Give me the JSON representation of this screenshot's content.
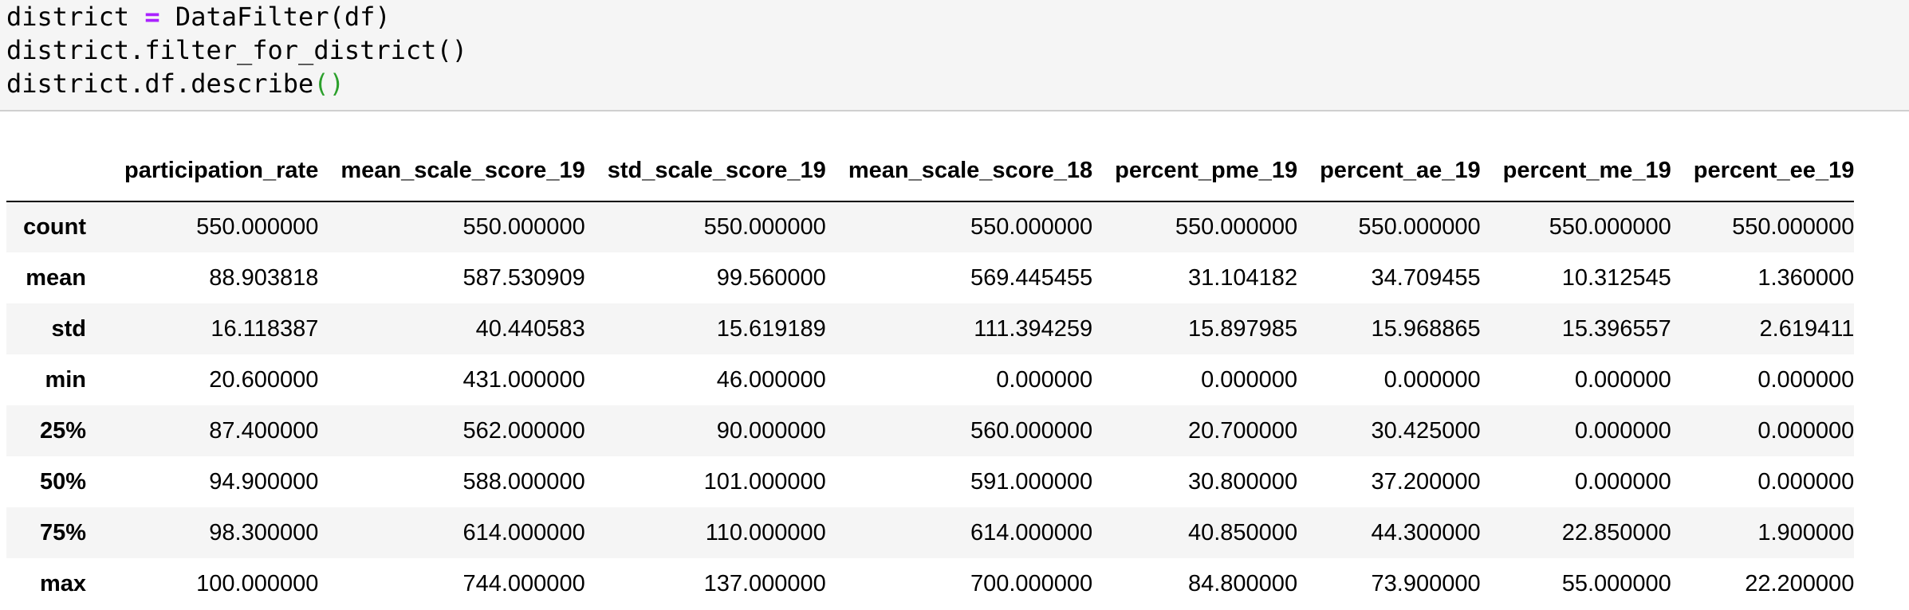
{
  "code": {
    "line1": {
      "var": "district",
      "op": "=",
      "rest": "DataFilter(df)"
    },
    "line2": "district.filter_for_district()",
    "line3": {
      "text": "district.df.describe",
      "parens": "()"
    }
  },
  "table": {
    "columns": [
      "participation_rate",
      "mean_scale_score_19",
      "std_scale_score_19",
      "mean_scale_score_18",
      "percent_pme_19",
      "percent_ae_19",
      "percent_me_19",
      "percent_ee_19"
    ],
    "rows": [
      {
        "label": "count",
        "values": [
          "550.000000",
          "550.000000",
          "550.000000",
          "550.000000",
          "550.000000",
          "550.000000",
          "550.000000",
          "550.000000"
        ]
      },
      {
        "label": "mean",
        "values": [
          "88.903818",
          "587.530909",
          "99.560000",
          "569.445455",
          "31.104182",
          "34.709455",
          "10.312545",
          "1.360000"
        ]
      },
      {
        "label": "std",
        "values": [
          "16.118387",
          "40.440583",
          "15.619189",
          "111.394259",
          "15.897985",
          "15.968865",
          "15.396557",
          "2.619411"
        ]
      },
      {
        "label": "min",
        "values": [
          "20.600000",
          "431.000000",
          "46.000000",
          "0.000000",
          "0.000000",
          "0.000000",
          "0.000000",
          "0.000000"
        ]
      },
      {
        "label": "25%",
        "values": [
          "87.400000",
          "562.000000",
          "90.000000",
          "560.000000",
          "20.700000",
          "30.425000",
          "0.000000",
          "0.000000"
        ]
      },
      {
        "label": "50%",
        "values": [
          "94.900000",
          "588.000000",
          "101.000000",
          "591.000000",
          "30.800000",
          "37.200000",
          "0.000000",
          "0.000000"
        ]
      },
      {
        "label": "75%",
        "values": [
          "98.300000",
          "614.000000",
          "110.000000",
          "614.000000",
          "40.850000",
          "44.300000",
          "22.850000",
          "1.900000"
        ]
      },
      {
        "label": "max",
        "values": [
          "100.000000",
          "744.000000",
          "137.000000",
          "700.000000",
          "84.800000",
          "73.900000",
          "55.000000",
          "22.200000"
        ]
      }
    ]
  }
}
